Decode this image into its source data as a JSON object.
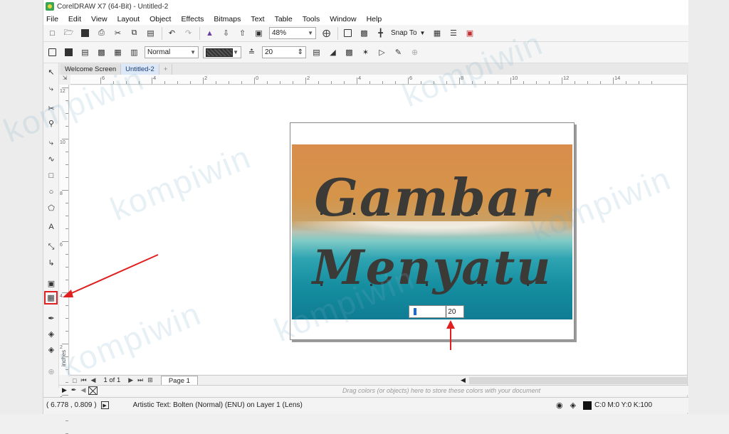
{
  "window": {
    "title": "CorelDRAW X7 (64-Bit) - Untitled-2"
  },
  "menu": [
    "File",
    "Edit",
    "View",
    "Layout",
    "Object",
    "Effects",
    "Bitmaps",
    "Text",
    "Table",
    "Tools",
    "Window",
    "Help"
  ],
  "toolbar1": {
    "zoom": "48%",
    "snap_label": "Snap To"
  },
  "toolbar2": {
    "blend_mode": "Normal",
    "rate": "20"
  },
  "doc_tabs": [
    {
      "label": "Welcome Screen",
      "active": false
    },
    {
      "label": "Untitled-2",
      "active": true
    }
  ],
  "ruler": {
    "h_labels": [
      "6",
      "4",
      "2",
      "0",
      "2",
      "4",
      "6",
      "8",
      "10",
      "12",
      "14"
    ],
    "v_labels": [
      "12",
      "10",
      "8",
      "6",
      "4",
      "2",
      "0"
    ],
    "units": "inches"
  },
  "canvas": {
    "text_line1": "Gambar",
    "text_line2": "Menyatu",
    "lens_value": "20",
    "lens_slider_fraction": 0.12
  },
  "page_nav": {
    "position": "1 of 1",
    "page_tab": "Page 1"
  },
  "palette_hint": "Drag colors (or objects) here to store these colors with your document",
  "status": {
    "coords": "( 6.778 , 0.809 )",
    "text": "Artistic Text: Bolten (Normal) (ENU) on Layer 1  (Lens)",
    "color": "C:0 M:0 Y:0 K:100"
  },
  "watermark": "kompiwin",
  "colors": {
    "accent_red": "#e02020",
    "slider_blue": "#1a6bd6"
  }
}
